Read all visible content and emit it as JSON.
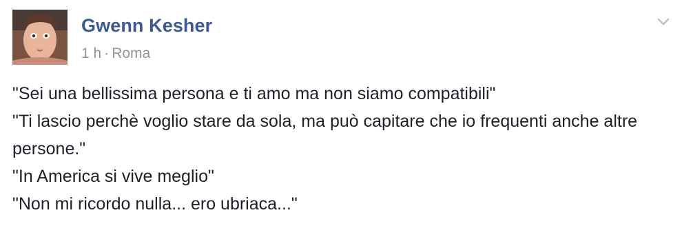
{
  "post": {
    "author": "Gwenn Kesher",
    "timestamp": "1 h",
    "separator": "·",
    "location": "Roma",
    "avatar_icon": "profile-photo",
    "options_icon": "chevron-down-icon",
    "lines": [
      "\"Sei una bellissima persona e ti amo ma non siamo compatibili\"",
      "\"Ti lascio perchè voglio stare da sola, ma può capitare che io frequenti anche altre persone.\"",
      "\"In America si vive meglio\"",
      "\"Non mi ricordo nulla... ero ubriaca...\""
    ]
  },
  "colors": {
    "author": "#3b5998",
    "meta": "#90949c",
    "text": "#1d2129",
    "chevron": "#bec3c9"
  }
}
